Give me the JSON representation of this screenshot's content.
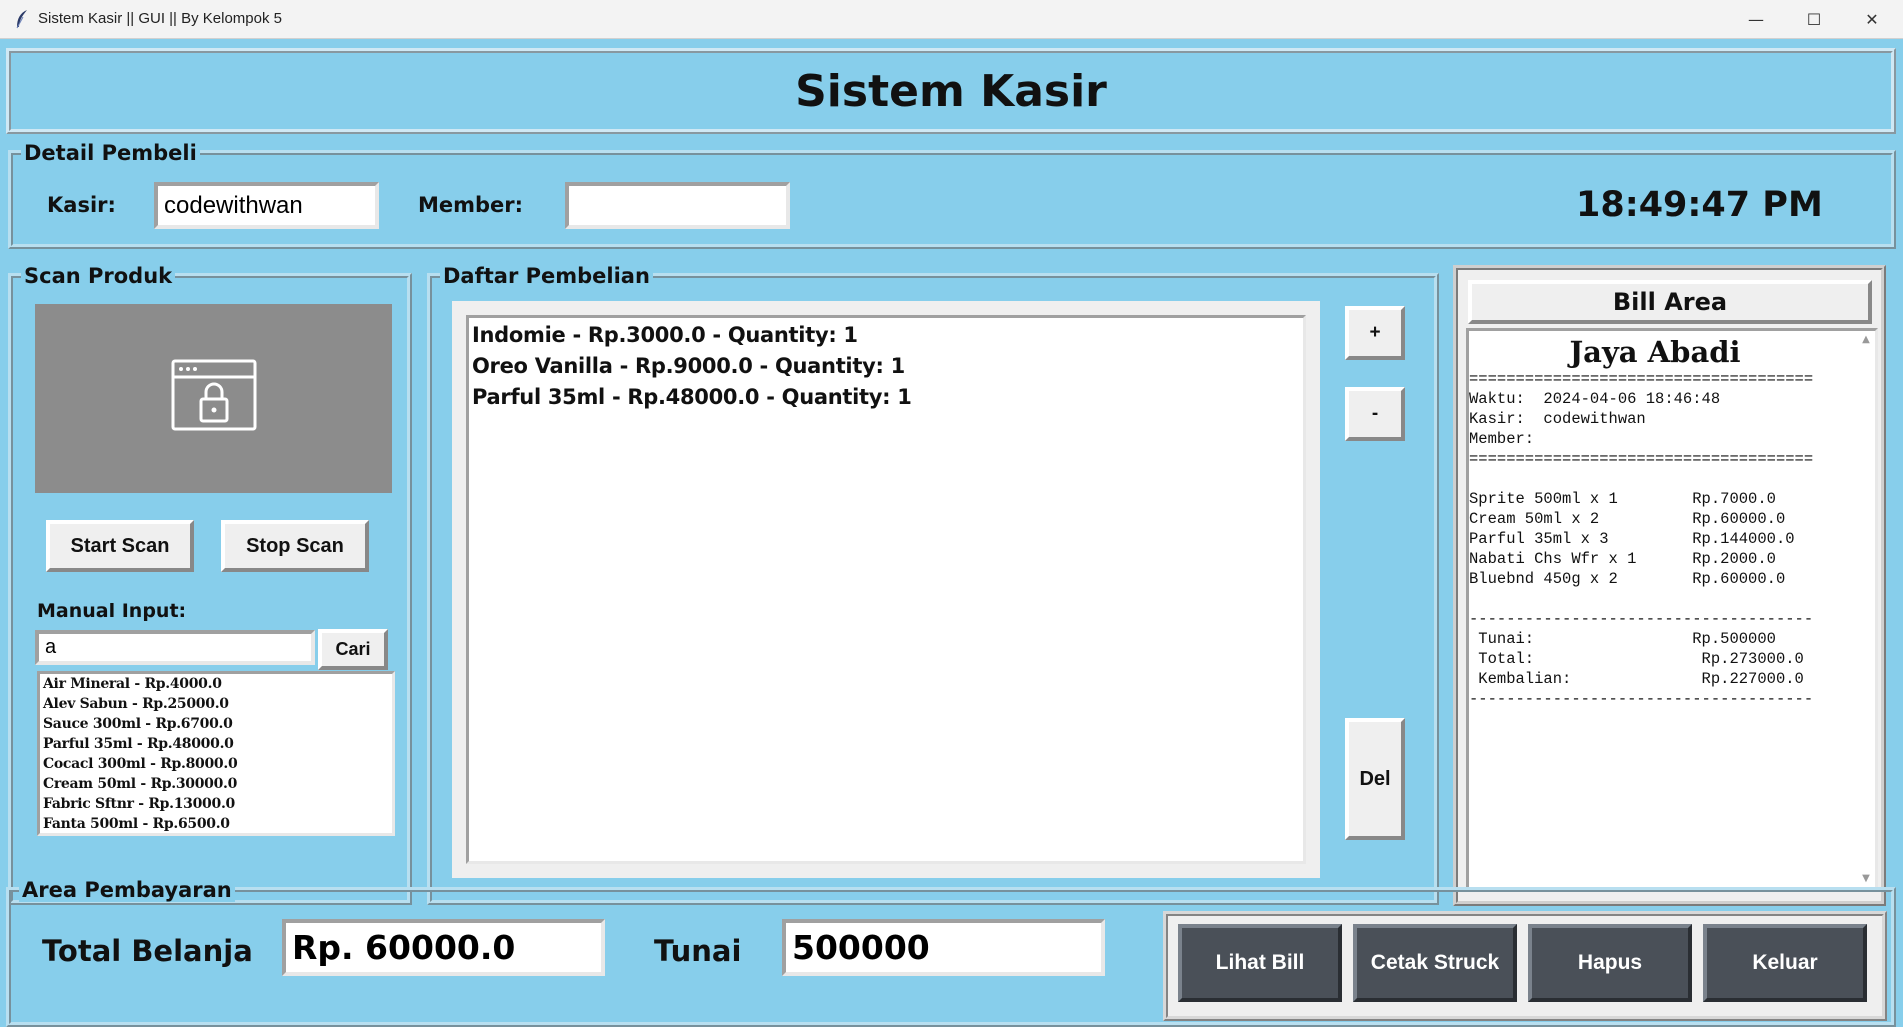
{
  "window": {
    "title": "Sistem Kasir || GUI || By Kelompok 5",
    "minimize": "—",
    "maximize": "☐",
    "close": "✕"
  },
  "header": {
    "title": "Sistem Kasir"
  },
  "detail": {
    "title": "Detail Pembeli",
    "kasir_label": "Kasir:",
    "kasir_value": "codewithwan",
    "member_label": "Member:",
    "member_value": "",
    "clock": "18:49:47 PM"
  },
  "scan": {
    "title": "Scan Produk",
    "camera_icon": "locked-browser-icon",
    "start_label": "Start Scan",
    "stop_label": "Stop Scan",
    "manual_label": "Manual Input:",
    "search_value": "a",
    "search_button": "Cari",
    "results": [
      "Air Mineral - Rp.4000.0",
      "Alev Sabun - Rp.25000.0",
      "Sauce 300ml - Rp.6700.0",
      "Parful 35ml - Rp.48000.0",
      "Cocacl 300ml - Rp.8000.0",
      "Cream 50ml - Rp.30000.0",
      "Fabric Sftnr - Rp.13000.0",
      "Fanta 500ml - Rp.6500.0"
    ]
  },
  "cart": {
    "title": "Daftar Pembelian",
    "items": [
      "Indomie - Rp.3000.0 - Quantity: 1",
      "Oreo Vanilla - Rp.9000.0 - Quantity: 1",
      "Parful 35ml - Rp.48000.0 - Quantity: 1"
    ],
    "plus_label": "+",
    "minus_label": "-",
    "del_label": "Del"
  },
  "bill": {
    "title": "Bill Area",
    "shop_name": "Jaya Abadi",
    "receipt": "=====================================\nWaktu:  2024-04-06 18:46:48\nKasir:  codewithwan\nMember:\n=====================================\n\nSprite 500ml x 1        Rp.7000.0\nCream 50ml x 2          Rp.60000.0\nParful 35ml x 3         Rp.144000.0\nNabati Chs Wfr x 1      Rp.2000.0\nBluebnd 450g x 2        Rp.60000.0\n\n-------------------------------------\n Tunai:                 Rp.500000\n Total:                  Rp.273000.0\n Kembalian:              Rp.227000.0\n-------------------------------------"
  },
  "payment": {
    "title": "Area Pembayaran",
    "total_label": "Total Belanja",
    "total_value": "Rp. 60000.0",
    "tunai_label": "Tunai",
    "tunai_value": "500000",
    "buttons": [
      "Lihat Bill",
      "Cetak Struck",
      "Hapus",
      "Keluar"
    ]
  }
}
